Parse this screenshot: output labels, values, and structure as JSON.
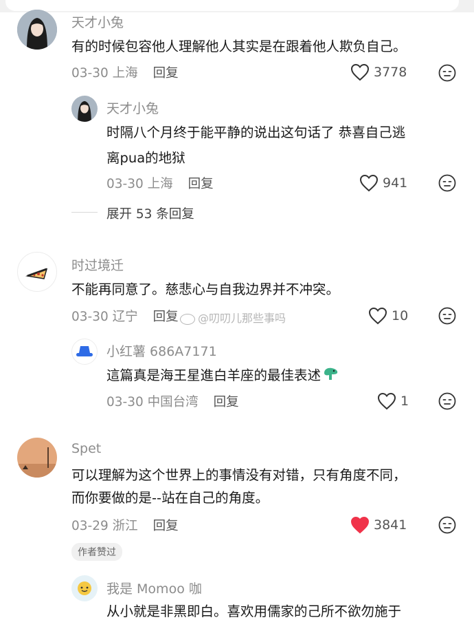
{
  "comments": [
    {
      "user": "天才小兔",
      "text": [
        "有的时候包容他人理解他人其实是在跟着他人欺负自己。"
      ],
      "date": "03-30",
      "location": "上海",
      "reply_label": "回复",
      "likes": "3778",
      "replies": [
        {
          "user": "天才小兔",
          "text": [
            "时隔八个月终于能平静的说出这句话了 恭喜自己逃",
            "离pua的地狱"
          ],
          "date": "03-30",
          "location": "上海",
          "reply_label": "回复",
          "likes": "941"
        }
      ],
      "expand_label": "展开 53 条回复"
    },
    {
      "user": "时过境迁",
      "text": [
        "不能再同意了。慈悲心与自我边界并不冲突。"
      ],
      "date": "03-30",
      "location": "辽宁",
      "reply_label": "回复",
      "likes": "10",
      "replies": [
        {
          "user": "小红薯 686A7171",
          "text": [
            "這篇真是海王星進白羊座的最佳表述"
          ],
          "date": "03-30",
          "location": "中国台湾",
          "reply_label": "回复",
          "likes": "1"
        }
      ]
    },
    {
      "user": "Spet",
      "text": [
        "可以理解为这个世界上的事情没有对错，只有角度不同，",
        "而你要做的是--站在自己的角度。"
      ],
      "date": "03-29",
      "location": "浙江",
      "reply_label": "回复",
      "likes": "3841",
      "liked": true,
      "author_badge": "作者赞过",
      "replies": [
        {
          "user": "我是 Momoo 咖",
          "text": [
            "从小就是非黑即白。喜欢用儒家的己所不欲勿施于"
          ]
        }
      ]
    }
  ],
  "watermark": "@叨叨儿那些事吗",
  "colors": {
    "liked_heart": "#f0334a",
    "muted": "#8c8c8c"
  }
}
